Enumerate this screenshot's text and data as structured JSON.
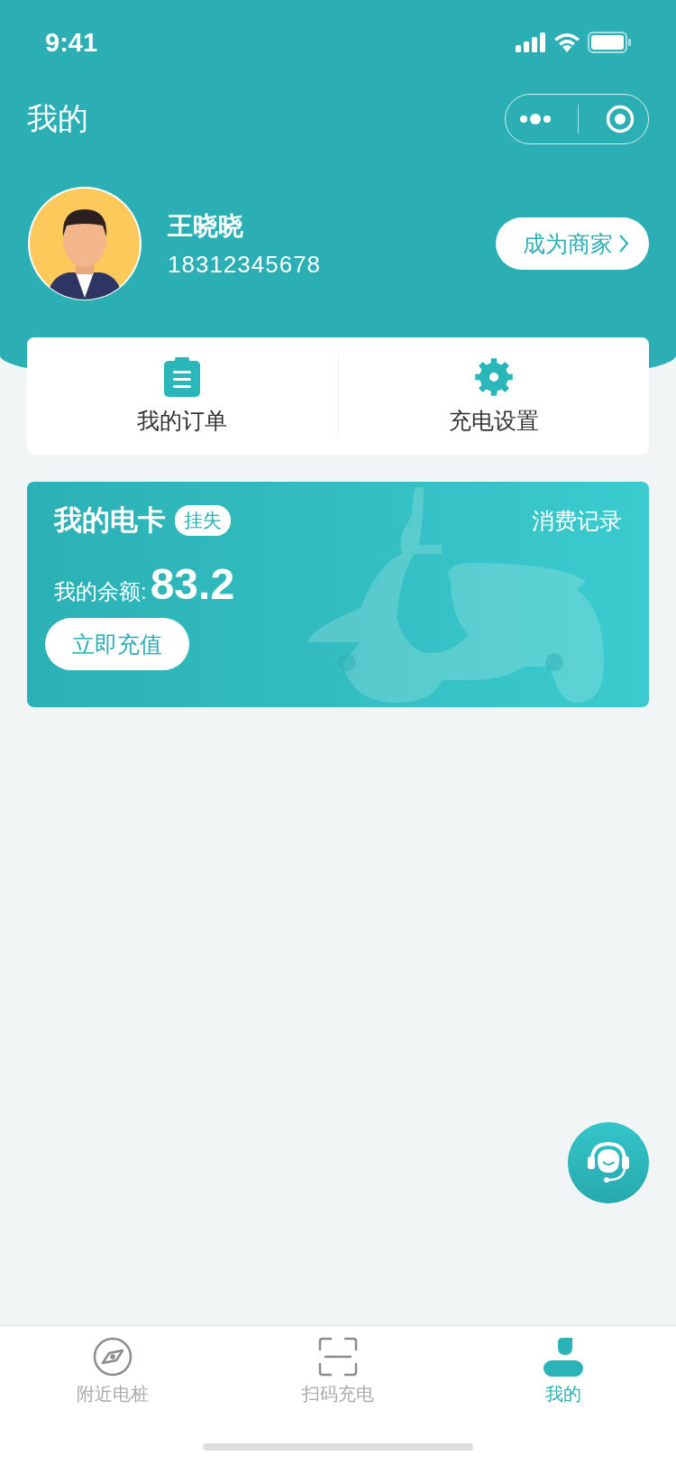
{
  "status_bar": {
    "time": "9:41"
  },
  "header": {
    "title": "我的"
  },
  "profile": {
    "name": "王晓晓",
    "phone": "18312345678",
    "merchant_button": "成为商家"
  },
  "shortcuts": [
    {
      "label": "我的订单",
      "kind": "orders"
    },
    {
      "label": "充电设置",
      "kind": "settings"
    }
  ],
  "card": {
    "title": "我的电卡",
    "tag": "挂失",
    "link": "消费记录",
    "balance_label": "我的余额:",
    "balance": "83.2",
    "recharge_button": "立即充值"
  },
  "tabs": [
    {
      "label": "附近电桩",
      "kind": "nearby",
      "selected": false
    },
    {
      "label": "扫码充电",
      "kind": "scan",
      "selected": false
    },
    {
      "label": "我的",
      "kind": "me",
      "selected": true
    }
  ]
}
